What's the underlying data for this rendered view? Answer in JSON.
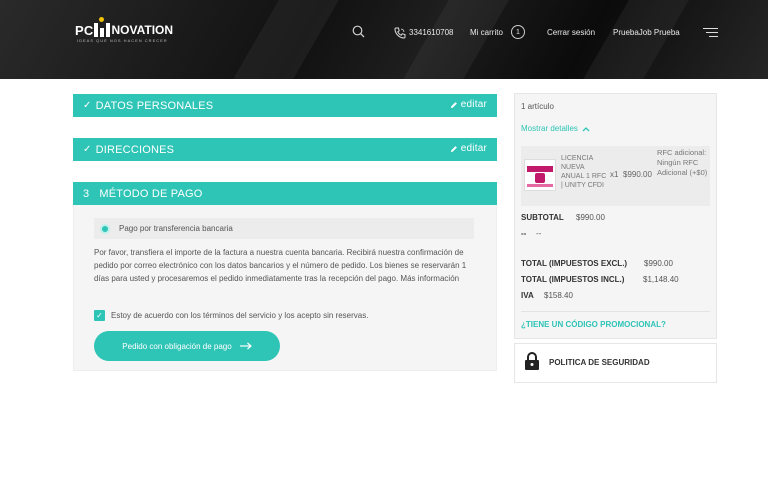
{
  "header": {
    "logo_pc": "PC",
    "logo_novation": "NOVATION",
    "logo_tagline": "IDEAS QUE NOS HACEN CRECER",
    "phone": "3341610708",
    "cart_label": "Mi carrito",
    "cart_count": "1",
    "logout": "Cerrar sesión",
    "user": "PruebaJob Prueba"
  },
  "checkout": {
    "personal_title": "DATOS PERSONALES",
    "addresses_title": "DIRECCIONES",
    "edit_label": "editar",
    "payment_num": "3",
    "payment_title": "MÉTODO DE PAGO",
    "payment_option": "Pago por transferencia bancaria",
    "payment_desc": "Por favor, transfiera el importe de la factura a nuestra cuenta bancaria. Recibirá nuestra confirmación de pedido por correo electrónico con los datos bancarios y el número de pedido. Los bienes se reservarán 1 días para usted y procesaremos el pedido inmediatamente tras la recepción del pago. Más información",
    "terms": "Estoy de acuerdo con los términos del servicio y los acepto sin reservas.",
    "submit": "Pedido con obligación de pago"
  },
  "summary": {
    "article_count": "1 artículo",
    "show_details": "Mostrar detalles",
    "item": {
      "name": "LICENCIA NUEVA ANUAL 1 RFC | UNITY CFDI",
      "qty": "x1",
      "price": "$990.00",
      "extra": "RFC adicional: Ningún RFC Adicional (+$0)"
    },
    "subtotal_label": "SUBTOTAL",
    "subtotal_value": "$990.00",
    "shipping_label": "--",
    "shipping_value": "--",
    "total_excl_label": "TOTAL (IMPUESTOS EXCL.)",
    "total_excl_value": "$990.00",
    "total_incl_label": "TOTAL (IMPUESTOS INCL.)",
    "total_incl_value": "$1,148.40",
    "iva_label": "IVA",
    "iva_value": "$158.40",
    "promo": "¿TIENE UN CÓDIGO PROMOCIONAL?"
  },
  "security": {
    "label": "POLITICA DE SEGURIDAD"
  },
  "colors": {
    "accent": "#2ec4b6",
    "logo_yellow": "#f4c400"
  }
}
